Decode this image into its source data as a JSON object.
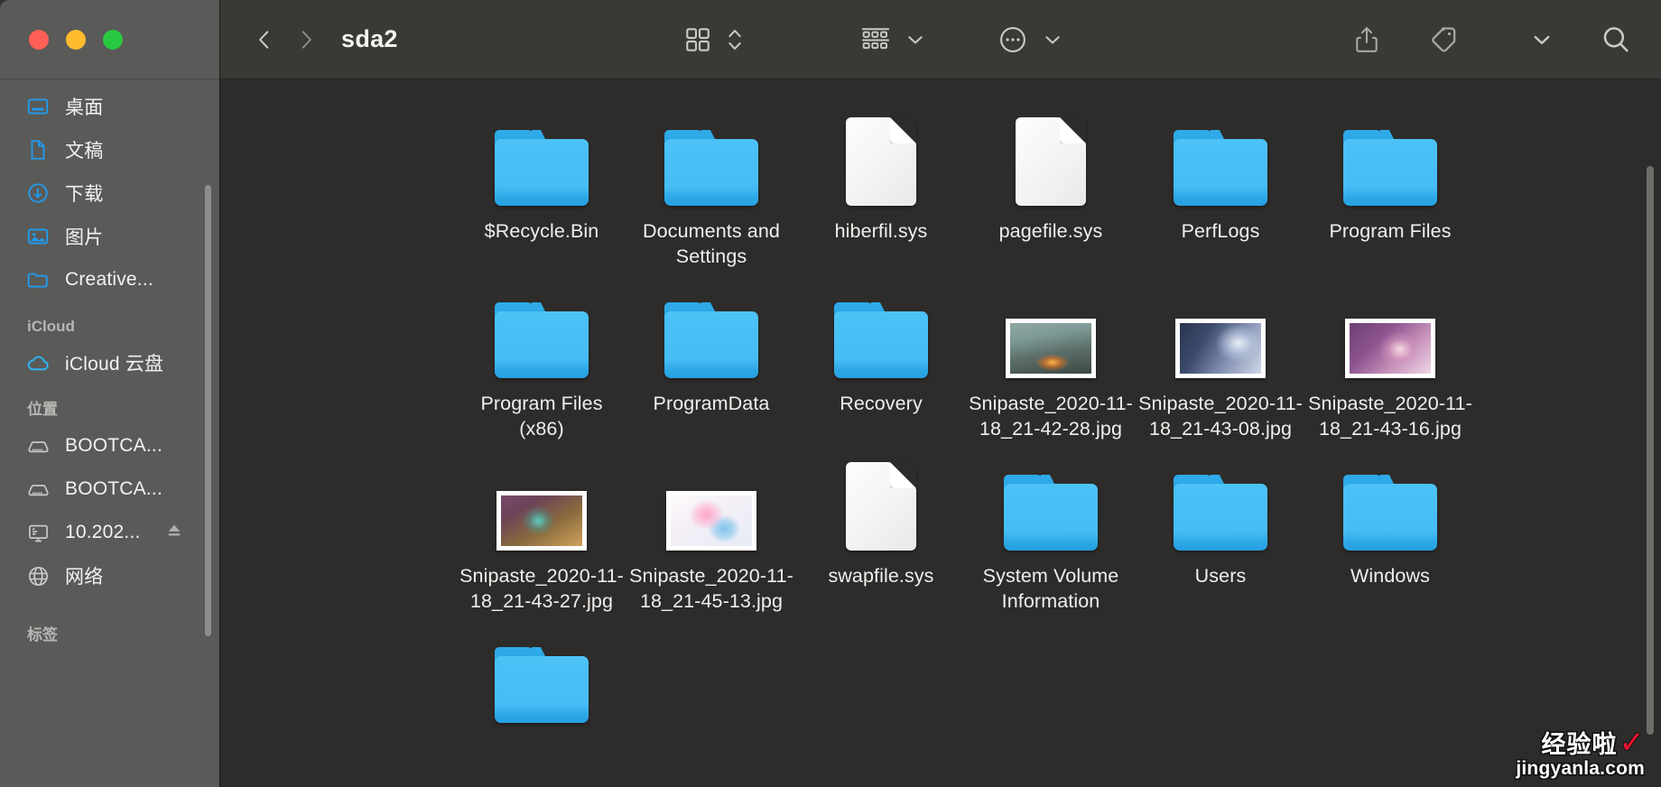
{
  "window": {
    "traffic_lights": [
      {
        "name": "close",
        "color": "#ff5f57"
      },
      {
        "name": "minimize",
        "color": "#febc2e"
      },
      {
        "name": "zoom",
        "color": "#28c840"
      }
    ]
  },
  "toolbar": {
    "back_icon": "chevron-left-icon",
    "forward_icon": "chevron-right-icon",
    "title": "sda2",
    "view_icon": "icon-view-grid-icon",
    "view_stepper_icon": "chevron-updown-icon",
    "group_icon": "group-by-icon",
    "group_chevron_icon": "chevron-down-icon",
    "more_icon": "ellipsis-circle-icon",
    "more_chevron_icon": "chevron-down-icon",
    "share_icon": "share-icon",
    "tag_icon": "tag-icon",
    "overflow_chevron_icon": "chevron-down-icon",
    "search_icon": "search-icon"
  },
  "sidebar": {
    "favorites": [
      {
        "label": "桌面",
        "icon": "desktop-icon"
      },
      {
        "label": "文稿",
        "icon": "document-icon"
      },
      {
        "label": "下载",
        "icon": "download-icon"
      },
      {
        "label": "图片",
        "icon": "pictures-icon"
      },
      {
        "label": "Creative...",
        "icon": "folder-icon"
      }
    ],
    "icloud_header": "iCloud",
    "icloud": [
      {
        "label": "iCloud 云盘",
        "icon": "cloud-icon"
      }
    ],
    "locations_header": "位置",
    "locations": [
      {
        "label": "BOOTCA...",
        "icon": "hard-disk-icon",
        "eject": false
      },
      {
        "label": "BOOTCA...",
        "icon": "hard-disk-icon",
        "eject": false
      },
      {
        "label": "10.202...",
        "icon": "server-icon",
        "eject": true
      },
      {
        "label": "网络",
        "icon": "globe-icon",
        "eject": false
      }
    ],
    "tags_header": "标签"
  },
  "files": [
    {
      "name": "$Recycle.Bin",
      "type": "folder"
    },
    {
      "name": "Documents and Settings",
      "type": "folder"
    },
    {
      "name": "hiberfil.sys",
      "type": "document"
    },
    {
      "name": "pagefile.sys",
      "type": "document"
    },
    {
      "name": "PerfLogs",
      "type": "folder"
    },
    {
      "name": "Program Files",
      "type": "folder"
    },
    {
      "name": "Program Files (x86)",
      "type": "folder"
    },
    {
      "name": "ProgramData",
      "type": "folder"
    },
    {
      "name": "Recovery",
      "type": "folder"
    },
    {
      "name": "Snipaste_2020-11-18_21-42-28.jpg",
      "type": "image",
      "thumb": "mecha-battle"
    },
    {
      "name": "Snipaste_2020-11-18_21-43-08.jpg",
      "type": "image",
      "thumb": "blue-knight"
    },
    {
      "name": "Snipaste_2020-11-18_21-43-16.jpg",
      "type": "image",
      "thumb": "purple-portrait"
    },
    {
      "name": "Snipaste_2020-11-18_21-43-27.jpg",
      "type": "image",
      "thumb": "sniper-girl"
    },
    {
      "name": "Snipaste_2020-11-18_21-45-13.jpg",
      "type": "image",
      "thumb": "pink-bunny"
    },
    {
      "name": "swapfile.sys",
      "type": "document"
    },
    {
      "name": "System Volume Information",
      "type": "folder"
    },
    {
      "name": "Users",
      "type": "folder"
    },
    {
      "name": "Windows",
      "type": "folder"
    },
    {
      "name": "",
      "type": "folder"
    }
  ],
  "watermark": {
    "cn": "经验啦",
    "check": "✓",
    "url": "jingyanla.com"
  },
  "colors": {
    "folder_blue": "#45bdf4",
    "sidebar_bg": "#5a5a58",
    "content_bg": "#2e2c2a",
    "toolbar_bg": "#3b3936",
    "accent_blue": "#1e9cf0",
    "watermark_red": "#e8112d"
  }
}
